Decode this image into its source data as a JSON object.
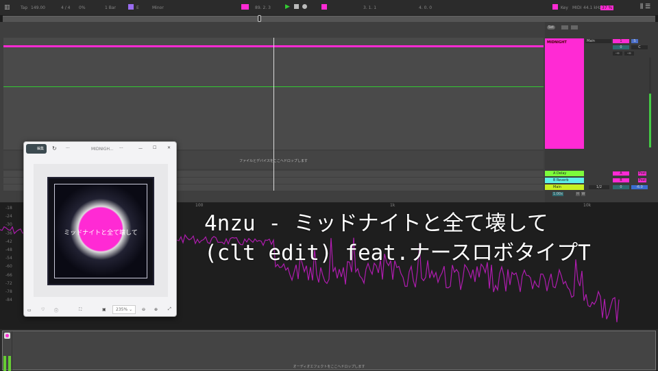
{
  "topbar": {
    "tap": "Tap",
    "tempo": "149.00",
    "sig": "4 / 4",
    "pct": "0%",
    "quant": "1 Bar",
    "key": "E",
    "scale": "Minor",
    "pos": "89.  2.  3",
    "loop_start": "3.  1.  1",
    "loop_len": "4.  0.  0",
    "key_label": "Key",
    "midi_label": "MIDI",
    "sample_rate": "44.1 kHz",
    "cpu": "37 %"
  },
  "arrangement": {
    "drop_text": "ファイルとデバイスをここへドロップします"
  },
  "mixer": {
    "set_label": "Set",
    "track_name": "MIDNIGHT",
    "output": "Main",
    "track_num": "1",
    "solo": "S",
    "vol": "0",
    "pan": "C",
    "inf1": "-∞",
    "inf2": "-∞",
    "returns": [
      {
        "name": "A Delay",
        "send": "A",
        "color": "#7cfc3c"
      },
      {
        "name": "B Reverb",
        "send": "B",
        "color": "#5ef0e8"
      },
      {
        "name": "Main",
        "send": "",
        "color": "#c8f020"
      }
    ],
    "post": "Post",
    "main_out": "1/2",
    "main_vol": "0",
    "main_db": "-6.0",
    "zoom": "1.00x",
    "h": "H",
    "w": "W"
  },
  "spectrum": {
    "y_labels": [
      "-18",
      "-24",
      "-30",
      "-36",
      "-42",
      "-48",
      "-54",
      "-60",
      "-66",
      "-72",
      "-78",
      "-84"
    ],
    "x_labels": [
      "100",
      "1k",
      "10k"
    ]
  },
  "overlay": {
    "line1": "4nzu - ミッドナイトと全て壊して",
    "line2": "(clt edit) feat.ナースロボタイプT"
  },
  "photo_viewer": {
    "edit_label": "編集",
    "title": "MIDNIGH...",
    "zoom": "235%",
    "min": "—",
    "max": "☐",
    "close": "✕",
    "more": "···",
    "cover_text": "ミッドナイトと全て壊して"
  },
  "device": {
    "drop_text": "オーディオエフェクトをここへドロップします"
  }
}
